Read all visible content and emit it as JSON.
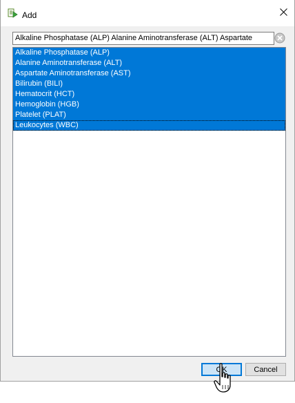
{
  "dialog": {
    "title": "Add",
    "title_icon": "add-item-icon",
    "close_icon": "close-icon"
  },
  "search": {
    "value": "Alkaline Phosphatase (ALP) Alanine Aminotransferase (ALT) Aspartate",
    "clear_icon": "clear-circle-icon"
  },
  "list": {
    "items": [
      {
        "label": "Alkaline Phosphatase (ALP)",
        "selected": true
      },
      {
        "label": "Alanine Aminotransferase (ALT)",
        "selected": true
      },
      {
        "label": "Aspartate Aminotransferase (AST)",
        "selected": true
      },
      {
        "label": "Bilirubin (BILI)",
        "selected": true
      },
      {
        "label": "Hematocrit (HCT)",
        "selected": true
      },
      {
        "label": "Hemoglobin (HGB)",
        "selected": true
      },
      {
        "label": "Platelet (PLAT)",
        "selected": true
      },
      {
        "label": "Leukocytes (WBC)",
        "selected": true,
        "focused": true
      }
    ]
  },
  "buttons": {
    "ok_label": "OK",
    "cancel_label": "Cancel"
  },
  "colors": {
    "selection": "#0078d7",
    "dialog_bg": "#f0f0f0"
  },
  "cursor": "hand-pointer-icon"
}
